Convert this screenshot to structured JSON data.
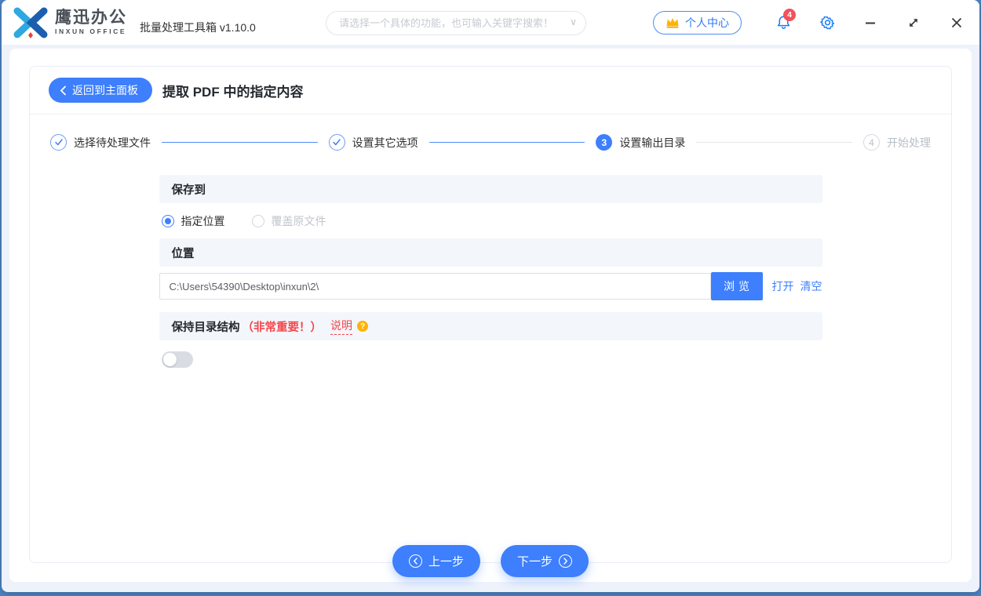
{
  "window": {
    "brand_name": "鹰迅办公",
    "brand_sub": "INXUN OFFICE",
    "app_title": "批量处理工具箱 v1.10.0",
    "search_placeholder": "请选择一个具体的功能，也可输入关键字搜索！",
    "user_center": "个人中心",
    "notification_count": "4"
  },
  "icons": {
    "chevron_down": "∨"
  },
  "page": {
    "back_label": "返回到主面板",
    "title": "提取 PDF 中的指定内容"
  },
  "steps": [
    {
      "label": "选择待处理文件",
      "state": "done"
    },
    {
      "label": "设置其它选项",
      "state": "done"
    },
    {
      "label": "设置输出目录",
      "state": "current",
      "number": "3"
    },
    {
      "label": "开始处理",
      "state": "pending",
      "number": "4"
    }
  ],
  "form": {
    "save_to": {
      "header": "保存到",
      "options": [
        {
          "label": "指定位置",
          "selected": true
        },
        {
          "label": "覆盖原文件",
          "selected": false,
          "disabled": true
        }
      ]
    },
    "location": {
      "header": "位置",
      "path_value": "C:\\Users\\54390\\Desktop\\inxun\\2\\",
      "browse_label": "浏览",
      "open_label": "打开",
      "clear_label": "清空"
    },
    "keep_structure": {
      "header": "保持目录结构",
      "important_note": "（非常重要！）",
      "help_label": "说明",
      "help_badge": "?",
      "toggle_on": false
    }
  },
  "footer": {
    "prev_label": "上一步",
    "next_label": "下一步"
  },
  "colors": {
    "primary": "#3D7FFC",
    "danger": "#F5464C",
    "warning": "#FFB302",
    "icon_blue": "#1A7AF8",
    "badge_red": "#F3515C"
  }
}
